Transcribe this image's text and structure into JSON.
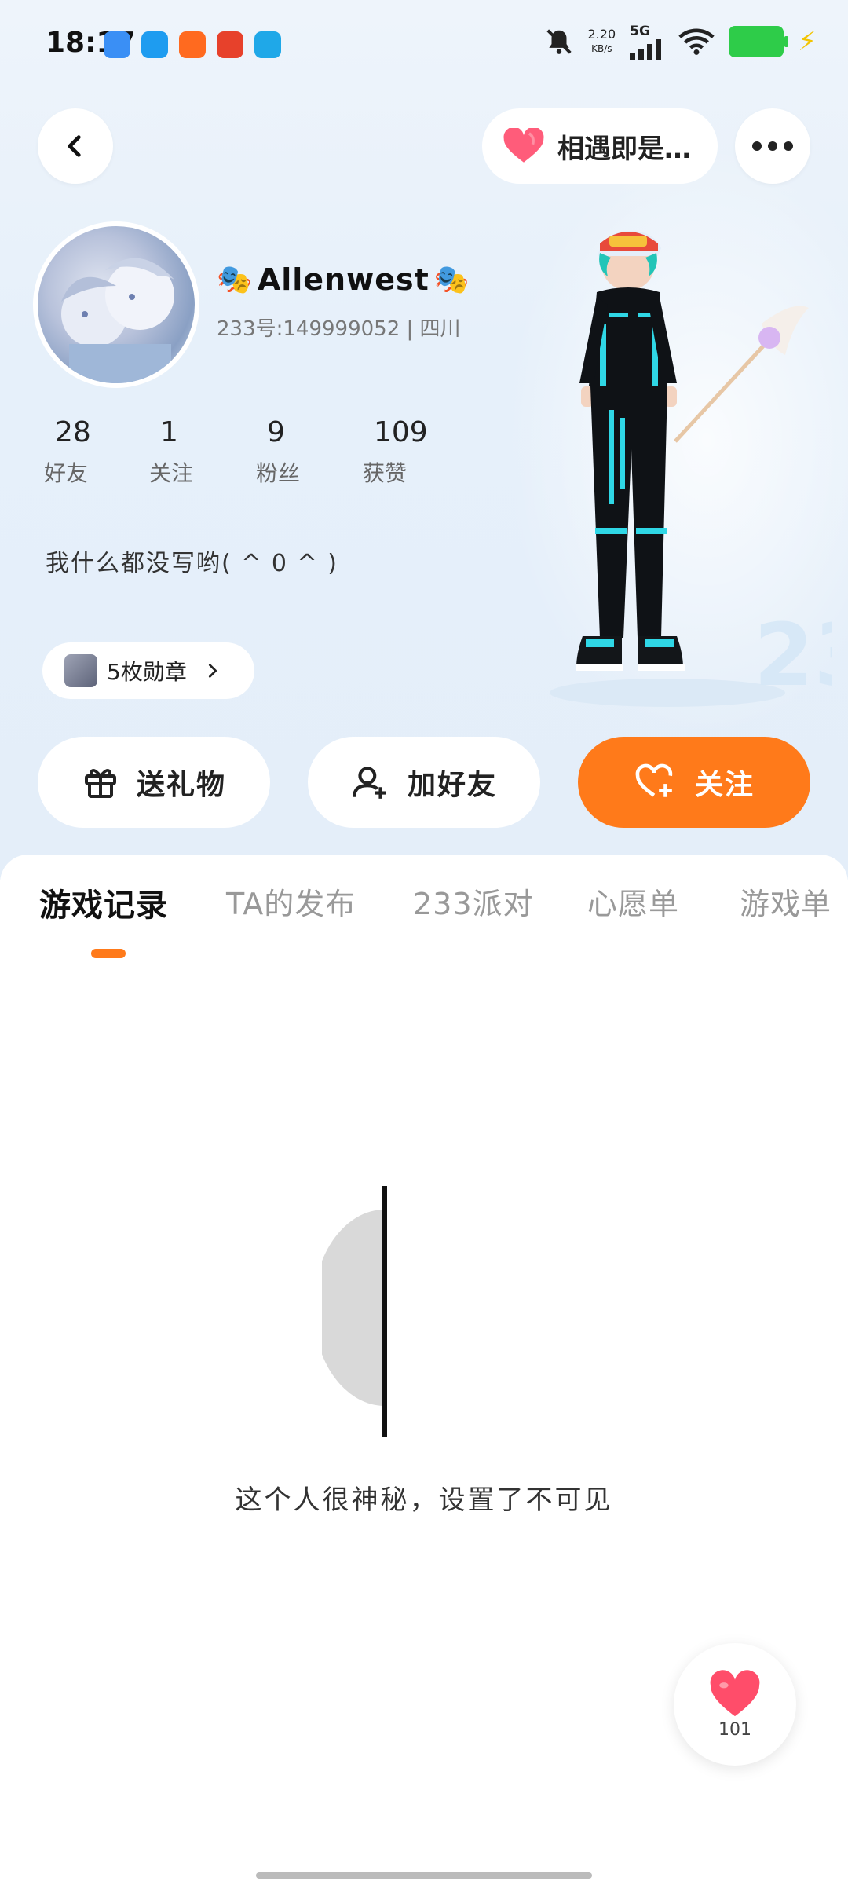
{
  "status_bar": {
    "time": "18:17",
    "net_speed_value": "2.20",
    "net_speed_unit": "KB/s",
    "network": "5G"
  },
  "header": {
    "match_pill_label": "相遇即是…"
  },
  "profile": {
    "name": "Allenwest",
    "uid_line": "233号:149999052 | 四川",
    "stats": [
      {
        "value": "28",
        "label": "好友"
      },
      {
        "value": "1",
        "label": "关注"
      },
      {
        "value": "9",
        "label": "粉丝"
      },
      {
        "value": "109",
        "label": "获赞"
      }
    ],
    "bio": "我什么都没写哟( ^ 0 ^ )",
    "badges_label": "5枚勋章"
  },
  "actions": {
    "gift": "送礼物",
    "add_friend": "加好友",
    "follow": "关注"
  },
  "tabs": [
    {
      "label": "游戏记录"
    },
    {
      "label": "TA的发布"
    },
    {
      "label": "233派对"
    },
    {
      "label": "心愿单"
    },
    {
      "label": "游戏单"
    }
  ],
  "empty_state": {
    "message": "这个人很神秘，设置了不可见"
  },
  "like_fab": {
    "count": "101"
  },
  "colors": {
    "accent": "#ff7a1a",
    "battery": "#2ecc49",
    "heart": "#ff4d6a"
  }
}
